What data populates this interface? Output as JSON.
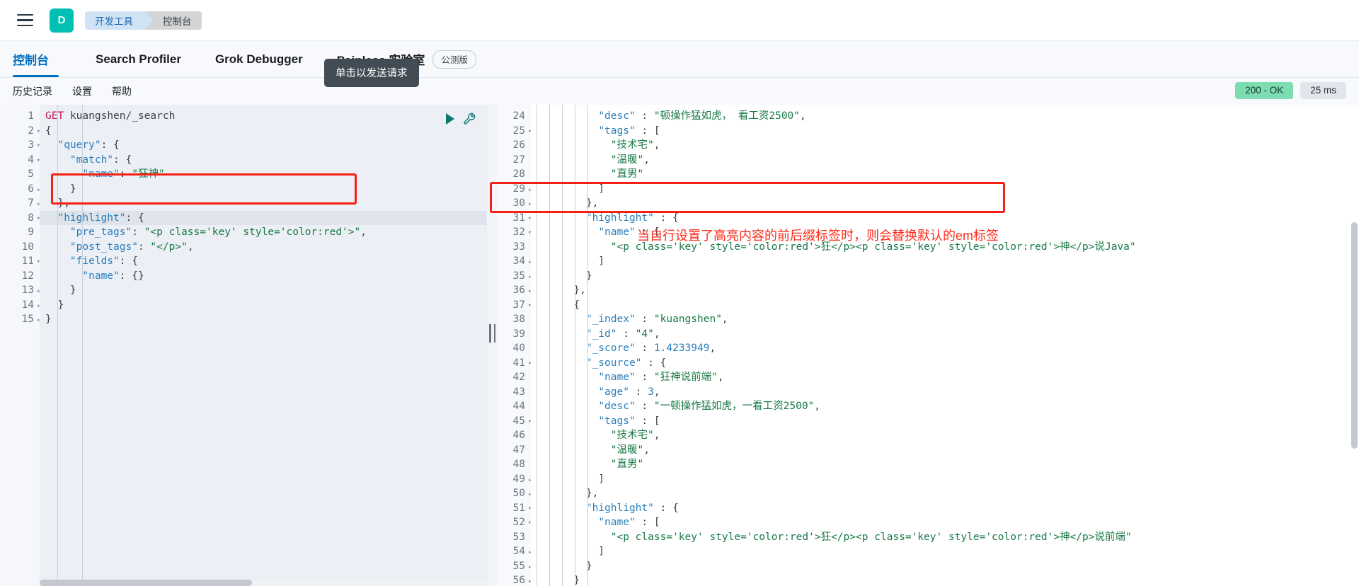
{
  "header": {
    "menu_icon": "hamburger-icon",
    "app_initial": "D",
    "breadcrumb": [
      "开发工具",
      "控制台"
    ]
  },
  "tabs": [
    {
      "label": "控制台",
      "active": true,
      "badge": null
    },
    {
      "label": "Search Profiler",
      "active": false,
      "badge": null
    },
    {
      "label": "Grok Debugger",
      "active": false,
      "badge": null
    },
    {
      "label": "Painless 实验室",
      "active": false,
      "badge": "公测版"
    }
  ],
  "tooltip": {
    "text": "单击以发送请求"
  },
  "subbar": {
    "items": [
      "历史记录",
      "设置",
      "帮助"
    ],
    "status_code": "200 - OK",
    "duration": "25 ms"
  },
  "icons": {
    "play": "play-icon",
    "wrench": "wrench-icon"
  },
  "request_editor": {
    "lines": [
      {
        "n": "1",
        "fold": "",
        "text": "GET kuangshen/_search",
        "type": "method"
      },
      {
        "n": "2",
        "fold": "▾",
        "text": "{"
      },
      {
        "n": "3",
        "fold": "▾",
        "text": "  \"query\": {"
      },
      {
        "n": "4",
        "fold": "▾",
        "text": "    \"match\": {"
      },
      {
        "n": "5",
        "fold": "",
        "text": "      \"name\": \"狂神\""
      },
      {
        "n": "6",
        "fold": "▴",
        "text": "    }"
      },
      {
        "n": "7",
        "fold": "▴",
        "text": "  },"
      },
      {
        "n": "8",
        "fold": "▾",
        "text": "  \"highlight\": {",
        "highlighted": true
      },
      {
        "n": "9",
        "fold": "",
        "text": "    \"pre_tags\": \"<p class='key' style='color:red'>\","
      },
      {
        "n": "10",
        "fold": "",
        "text": "    \"post_tags\": \"</p>\","
      },
      {
        "n": "11",
        "fold": "▾",
        "text": "    \"fields\": {"
      },
      {
        "n": "12",
        "fold": "",
        "text": "      \"name\": {}"
      },
      {
        "n": "13",
        "fold": "▴",
        "text": "    }"
      },
      {
        "n": "14",
        "fold": "▴",
        "text": "  }"
      },
      {
        "n": "15",
        "fold": "▴",
        "text": "}"
      }
    ]
  },
  "response_viewer": {
    "lines": [
      {
        "n": "24",
        "fold": "",
        "text": "          \"desc\" : \"顿操作猛如虎， 看工资2500\","
      },
      {
        "n": "25",
        "fold": "▾",
        "text": "          \"tags\" : ["
      },
      {
        "n": "26",
        "fold": "",
        "text": "            \"技术宅\","
      },
      {
        "n": "27",
        "fold": "",
        "text": "            \"温暖\","
      },
      {
        "n": "28",
        "fold": "",
        "text": "            \"直男\""
      },
      {
        "n": "29",
        "fold": "▴",
        "text": "          ]"
      },
      {
        "n": "30",
        "fold": "▴",
        "text": "        },"
      },
      {
        "n": "31",
        "fold": "▾",
        "text": "        \"highlight\" : {"
      },
      {
        "n": "32",
        "fold": "▾",
        "text": "          \"name\" : ["
      },
      {
        "n": "33",
        "fold": "",
        "text": "            \"<p class='key' style='color:red'>狂</p><p class='key' style='color:red'>神</p>说Java\""
      },
      {
        "n": "34",
        "fold": "▴",
        "text": "          ]"
      },
      {
        "n": "35",
        "fold": "▴",
        "text": "        }"
      },
      {
        "n": "36",
        "fold": "▴",
        "text": "      },"
      },
      {
        "n": "37",
        "fold": "▾",
        "text": "      {"
      },
      {
        "n": "38",
        "fold": "",
        "text": "        \"_index\" : \"kuangshen\","
      },
      {
        "n": "39",
        "fold": "",
        "text": "        \"_id\" : \"4\","
      },
      {
        "n": "40",
        "fold": "",
        "text": "        \"_score\" : 1.4233949,"
      },
      {
        "n": "41",
        "fold": "▾",
        "text": "        \"_source\" : {"
      },
      {
        "n": "42",
        "fold": "",
        "text": "          \"name\" : \"狂神说前端\","
      },
      {
        "n": "43",
        "fold": "",
        "text": "          \"age\" : 3,"
      },
      {
        "n": "44",
        "fold": "",
        "text": "          \"desc\" : \"一顿操作猛如虎，一看工资2500\","
      },
      {
        "n": "45",
        "fold": "▾",
        "text": "          \"tags\" : ["
      },
      {
        "n": "46",
        "fold": "",
        "text": "            \"技术宅\","
      },
      {
        "n": "47",
        "fold": "",
        "text": "            \"温暖\","
      },
      {
        "n": "48",
        "fold": "",
        "text": "            \"直男\""
      },
      {
        "n": "49",
        "fold": "▴",
        "text": "          ]"
      },
      {
        "n": "50",
        "fold": "▴",
        "text": "        },"
      },
      {
        "n": "51",
        "fold": "▾",
        "text": "        \"highlight\" : {"
      },
      {
        "n": "52",
        "fold": "▾",
        "text": "          \"name\" : ["
      },
      {
        "n": "53",
        "fold": "",
        "text": "            \"<p class='key' style='color:red'>狂</p><p class='key' style='color:red'>神</p>说前端\""
      },
      {
        "n": "54",
        "fold": "▴",
        "text": "          ]"
      },
      {
        "n": "55",
        "fold": "▴",
        "text": "        }"
      },
      {
        "n": "56",
        "fold": "▴",
        "text": "      }"
      }
    ]
  },
  "annotations": {
    "note_text": "当自行设置了高亮内容的前后缀标签时，则会替换默认的em标签",
    "accent_color": "#ff2b1a"
  },
  "colors": {
    "brand_teal": "#00bfb3",
    "link_blue": "#0070c4",
    "status_green": "#7ddcb0",
    "annotation_red": "#f32013"
  }
}
